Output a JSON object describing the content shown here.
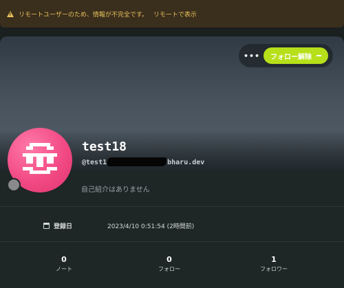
{
  "notice": {
    "message": "リモートユーザーのため、情報が不完全です。",
    "link": "リモートで表示"
  },
  "header": {
    "more_label": "•••",
    "follow_label": "フォロー解除"
  },
  "profile": {
    "username": "test18",
    "acct_prefix": "@test1",
    "acct_suffix": "bharu.dev",
    "bio": "自己紹介はありません",
    "joined_label": "登録日",
    "joined_value": "2023/4/10 0:51:54 (2時間前)"
  },
  "stats": [
    {
      "value": "0",
      "label": "ノート"
    },
    {
      "value": "0",
      "label": "フォロー"
    },
    {
      "value": "1",
      "label": "フォロワー"
    }
  ],
  "colors": {
    "accent": "#b7e01a",
    "notice_text": "#e8c15c",
    "avatar": "#f24a84"
  }
}
